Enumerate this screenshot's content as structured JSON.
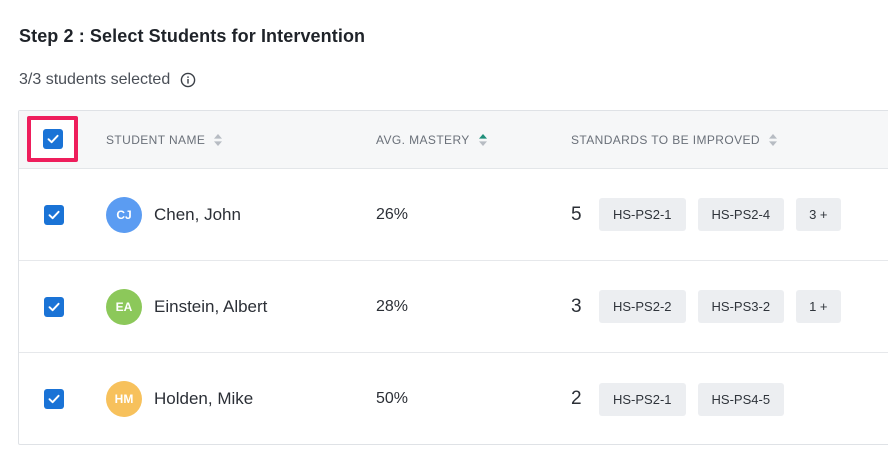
{
  "header": {
    "step_title": "Step 2 : Select Students for Intervention",
    "selected_summary": "3/3 students selected",
    "info_icon": "info-circle-icon"
  },
  "table": {
    "columns": {
      "student_name": "STUDENT NAME",
      "avg_mastery": "AVG. MASTERY",
      "standards": "STANDARDS TO BE IMPROVED"
    },
    "sort": {
      "active_column": "avg_mastery",
      "active_color": "#1f8f7a",
      "inactive_color": "#b7bcc3"
    },
    "select_all_checked": true,
    "rows": [
      {
        "checked": true,
        "initials": "CJ",
        "avatar_color": "#5b9cf2",
        "name": "Chen, John",
        "mastery": "26%",
        "standards_count": "5",
        "standards": [
          "HS-PS2-1",
          "HS-PS2-4"
        ],
        "more": "3 +"
      },
      {
        "checked": true,
        "initials": "EA",
        "avatar_color": "#8cc85a",
        "name": "Einstein, Albert",
        "mastery": "28%",
        "standards_count": "3",
        "standards": [
          "HS-PS2-2",
          "HS-PS3-2"
        ],
        "more": "1 +"
      },
      {
        "checked": true,
        "initials": "HM",
        "avatar_color": "#f7c15c",
        "name": "Holden, Mike",
        "mastery": "50%",
        "standards_count": "2",
        "standards": [
          "HS-PS2-1",
          "HS-PS4-5"
        ],
        "more": ""
      }
    ]
  },
  "colors": {
    "checkbox": "#1a73d6",
    "highlight_border": "#ee1e5c"
  }
}
